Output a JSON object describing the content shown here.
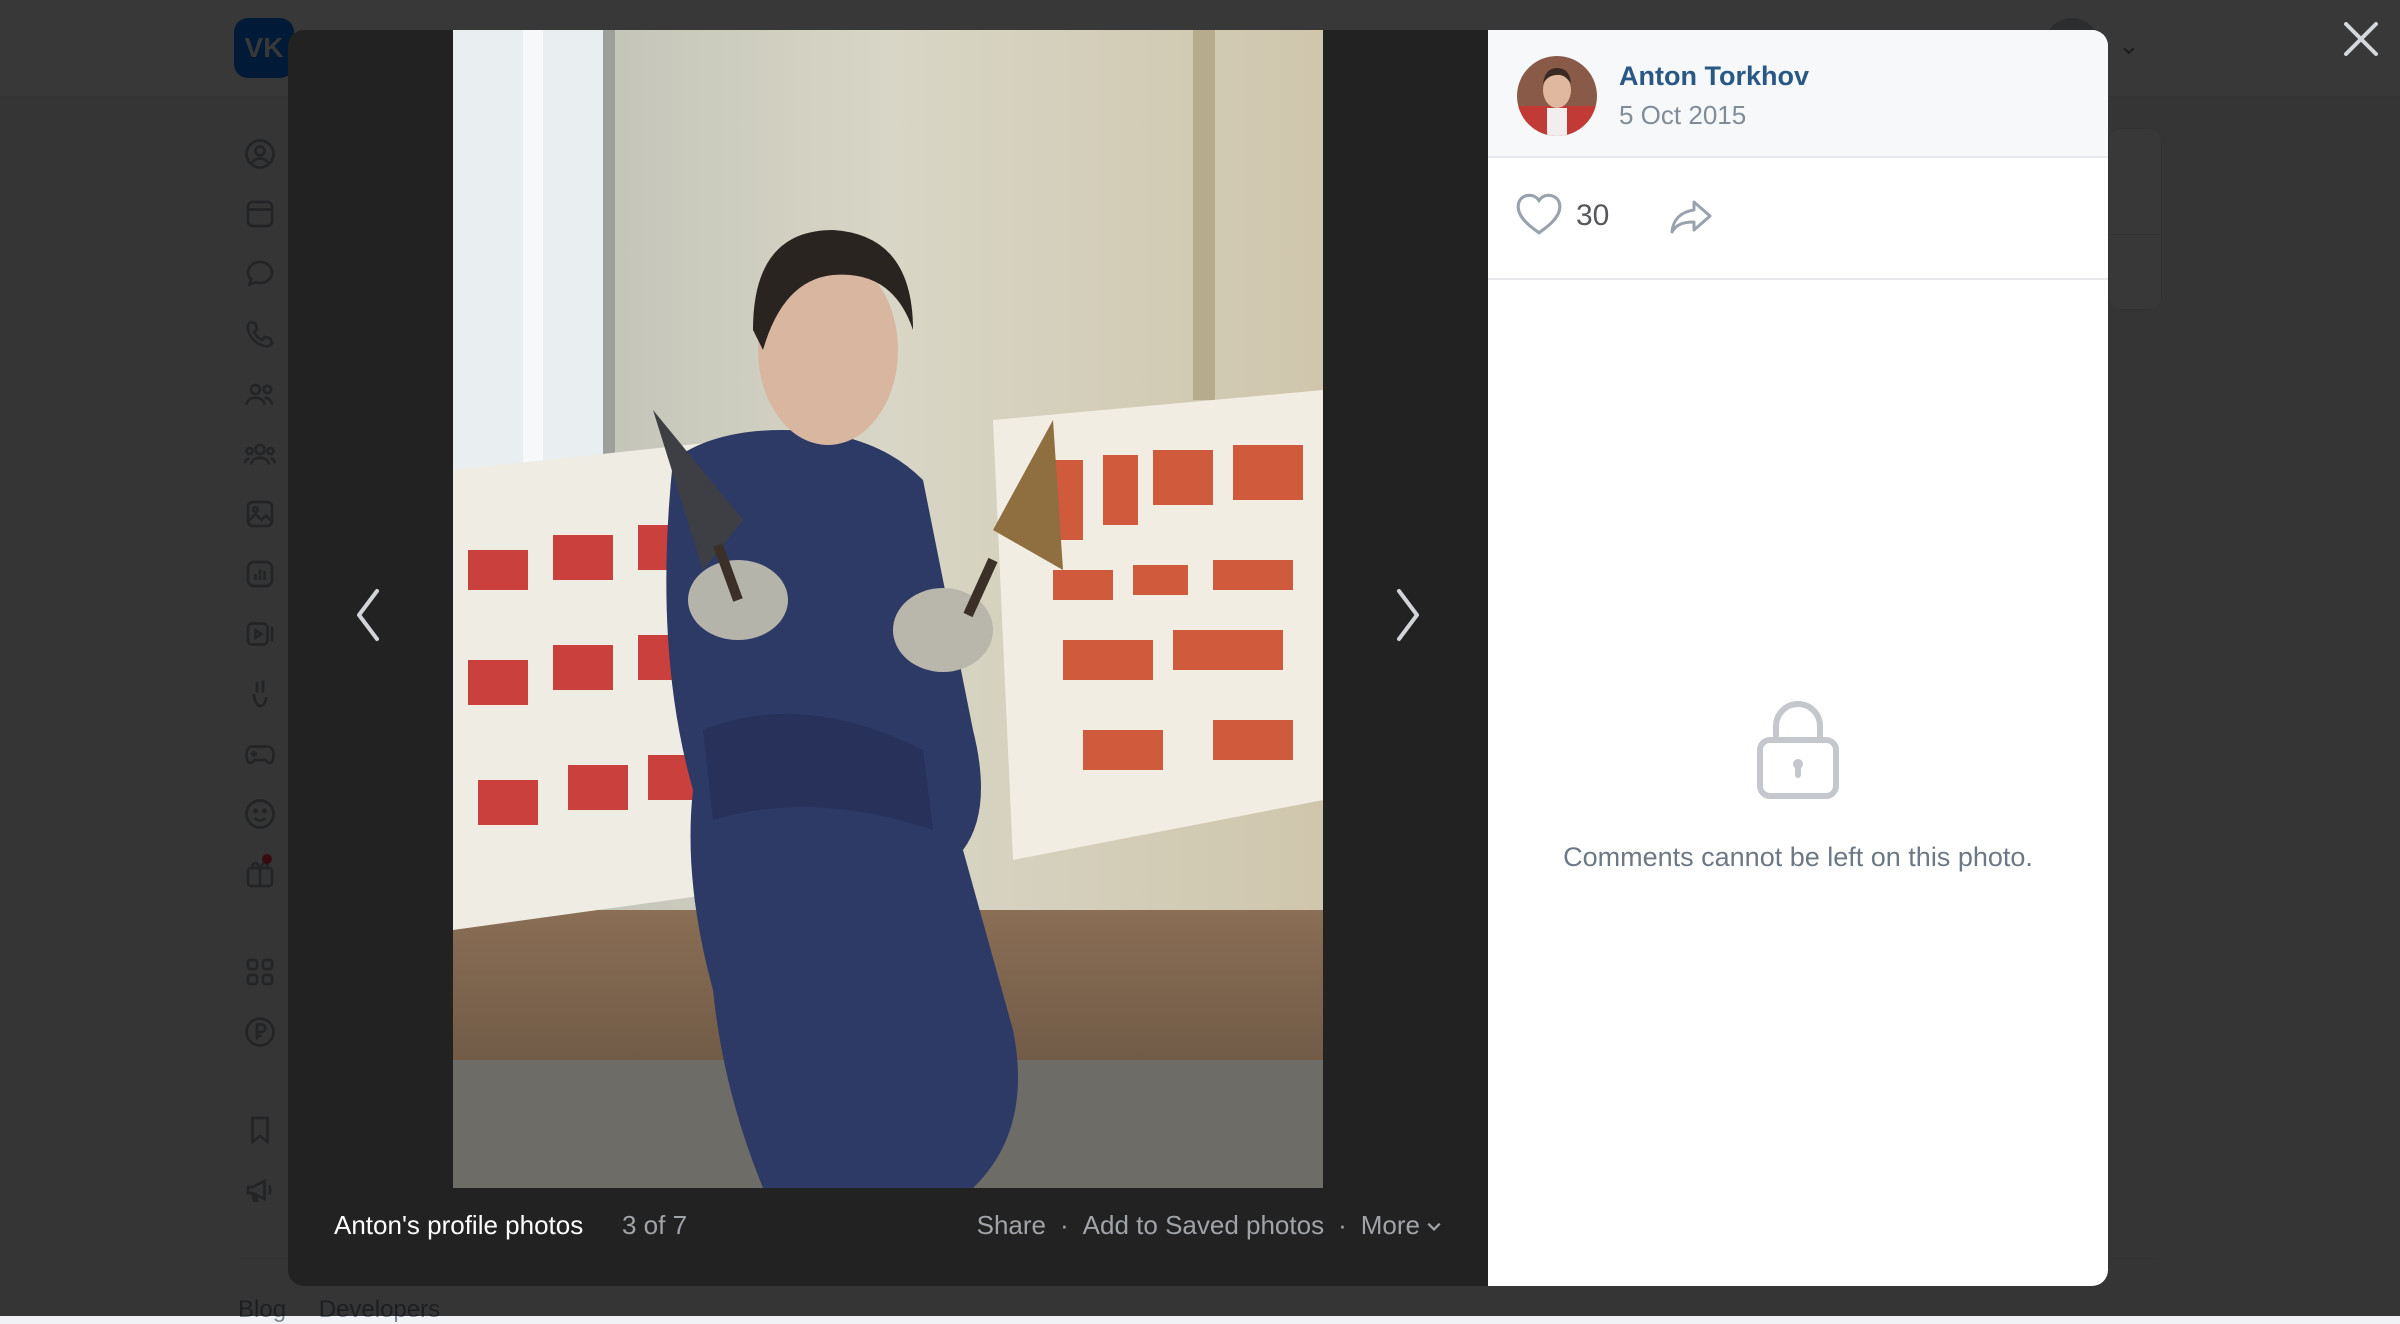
{
  "background": {
    "logo_text": "VK",
    "nav_icons": [
      "profile-icon",
      "news-icon",
      "messenger-icon",
      "calls-icon",
      "friends-icon",
      "communities-icon",
      "photos-icon",
      "music-icon",
      "video-icon",
      "clips-icon",
      "games-icon",
      "stickers-icon",
      "gifts-icon",
      "services-icon",
      "payments-icon",
      "bookmarks-icon",
      "ads-icon"
    ],
    "footer_links": [
      "Blog",
      "Developers"
    ]
  },
  "viewer": {
    "author": {
      "name": "Anton Torkhov",
      "date": "5 Oct 2015"
    },
    "likes": "30",
    "comments_disabled_text": "Comments cannot be left on this photo.",
    "album_title": "Anton's profile photos",
    "counter": "3 of 7",
    "actions": {
      "share": "Share",
      "save": "Add to Saved photos",
      "more": "More",
      "separator": "·"
    }
  },
  "colors": {
    "accent": "#2a5885",
    "vk_blue": "#0077ff",
    "overlay": "#222222"
  }
}
